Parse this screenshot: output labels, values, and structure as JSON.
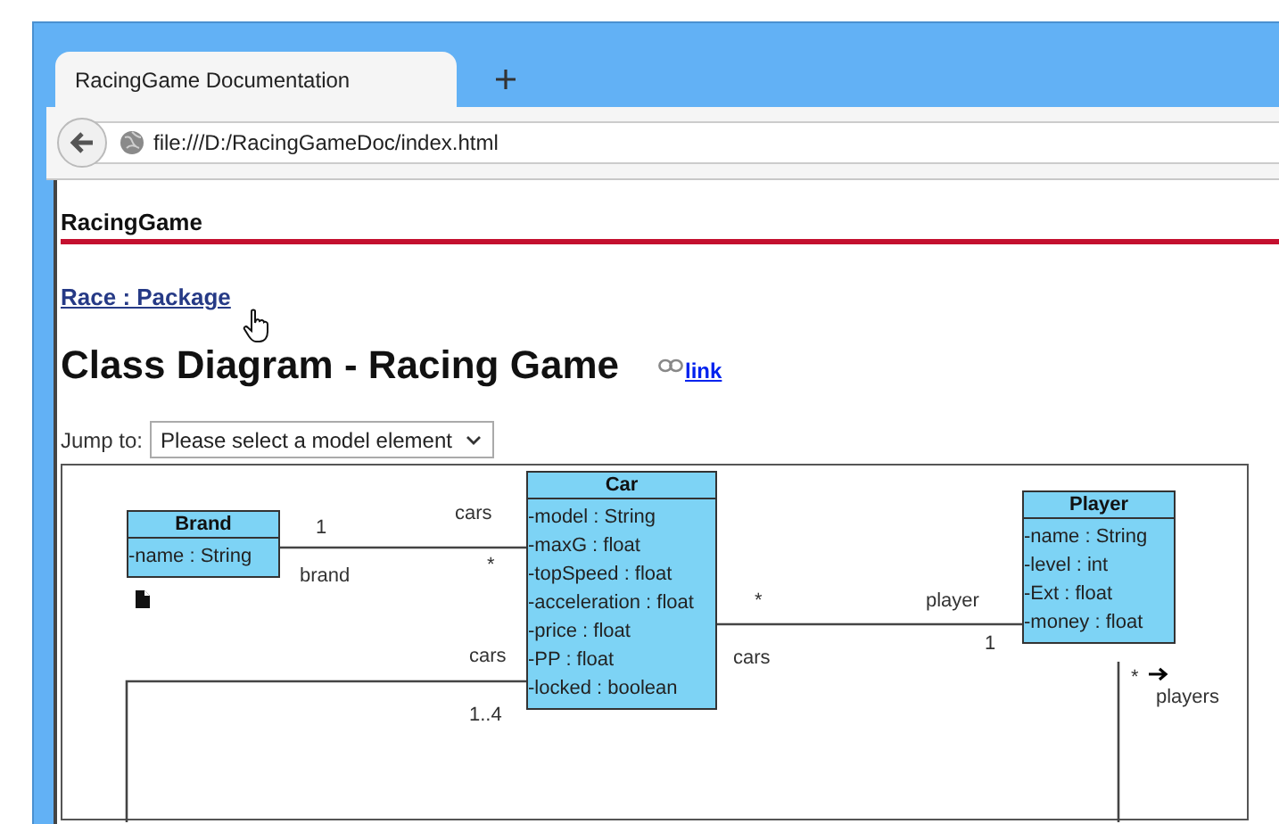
{
  "browser": {
    "tabs": [
      {
        "title": "RacingGame Documentation",
        "selected": true
      }
    ],
    "address": "file:///D:/RacingGameDoc/index.html"
  },
  "page": {
    "project": "RacingGame",
    "breadcrumb": "Race : Package",
    "title": "Class Diagram - Racing Game",
    "permalink": "link",
    "jump_to": {
      "label": "Jump to:",
      "value": "Please select a model element"
    }
  },
  "diagram": {
    "classes": [
      {
        "name": "Brand",
        "attributes": [
          "-name : String"
        ],
        "has_doc": true
      },
      {
        "name": "Car",
        "attributes": [
          "-model : String",
          "-maxG : float",
          "-topSpeed : float",
          "-acceleration : float",
          "-price : float",
          "-PP : float",
          "-locked : boolean"
        ],
        "has_doc": false
      },
      {
        "name": "Player",
        "attributes": [
          "-name : String",
          "-level : int",
          "-Ext : float",
          "-money : float"
        ],
        "has_doc": false
      }
    ],
    "associations": [
      {
        "ends": [
          {
            "multiplicity": "1",
            "role": "brand",
            "navigable": false
          },
          {
            "multiplicity": "*",
            "role": "cars",
            "navigable": false
          }
        ]
      },
      {
        "ends": [
          {
            "multiplicity": "*",
            "role": "cars",
            "navigable": false
          },
          {
            "multiplicity": "1",
            "role": "player",
            "navigable": false
          }
        ]
      },
      {
        "ends": [
          {
            "multiplicity": "1..4",
            "role": "cars",
            "navigable": false
          }
        ]
      },
      {
        "ends": [
          {
            "multiplicity": "*",
            "role": "players",
            "navigable": true
          }
        ]
      }
    ]
  }
}
